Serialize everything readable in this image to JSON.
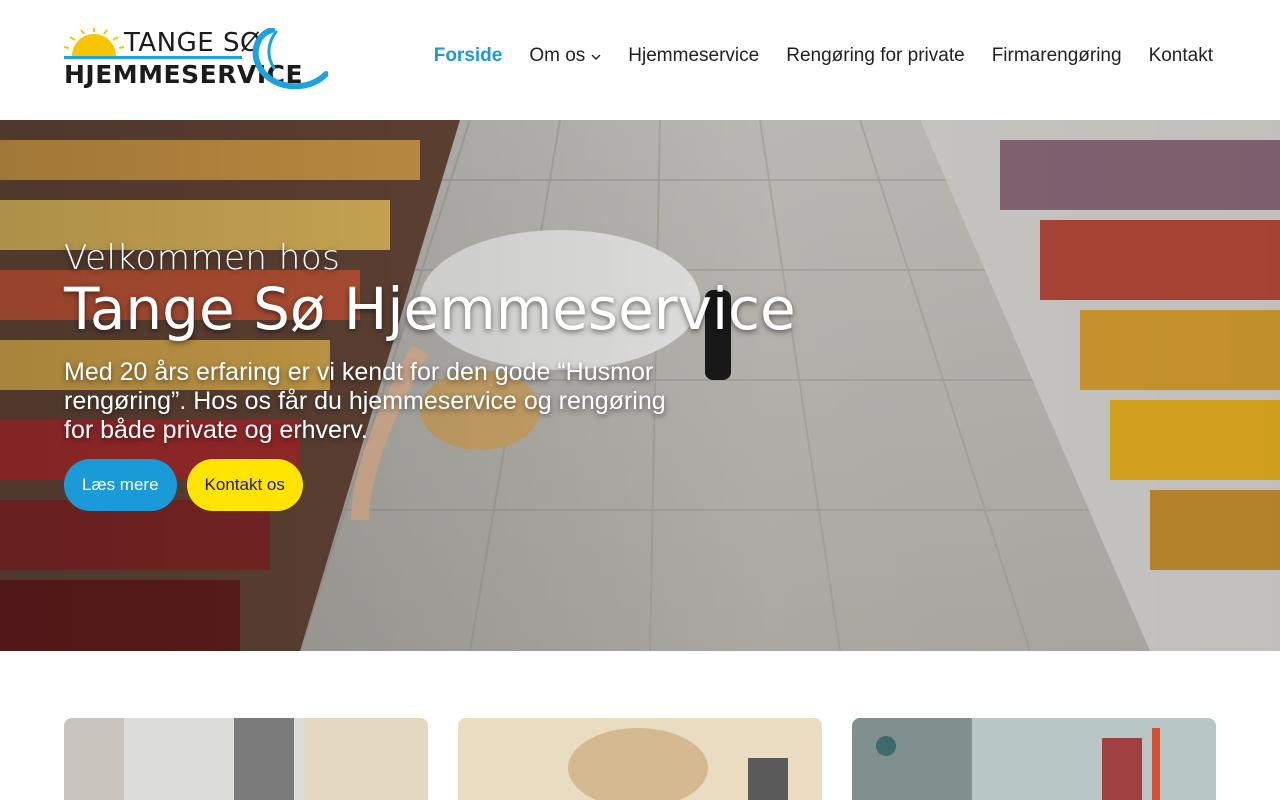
{
  "logo": {
    "line1": "TANGE SØ",
    "line2": "HJEMMESERVICE",
    "sun_icon": "sun-icon",
    "swoosh_icon": "lake-swoosh-icon",
    "colors": {
      "sun": "#f7c600",
      "swoosh": "#1aa3e0"
    }
  },
  "nav": {
    "items": [
      {
        "label": "Forside",
        "active": true
      },
      {
        "label": "Om os",
        "has_dropdown": true
      },
      {
        "label": "Hjemmeservice"
      },
      {
        "label": "Rengøring for private"
      },
      {
        "label": "Firmarengøring"
      },
      {
        "label": "Kontakt"
      }
    ],
    "dropdown_icon": "chevron-down-icon",
    "active_color": "#1a9ad6"
  },
  "hero": {
    "subtitle": "Velkommen hos",
    "title": "Tange Sø Hjemmeservice",
    "description": "Med 20 års erfaring er vi kendt for den gode “Husmor rengøring”. Hos os får du hjemmeservice og rengøring for både private og erhverv.",
    "buttons": {
      "primary": "Læs mere",
      "secondary": "Kontakt os"
    },
    "colors": {
      "primary": "#1a9ad6",
      "secondary": "#ffe400"
    }
  },
  "cards": {
    "count": 3
  }
}
